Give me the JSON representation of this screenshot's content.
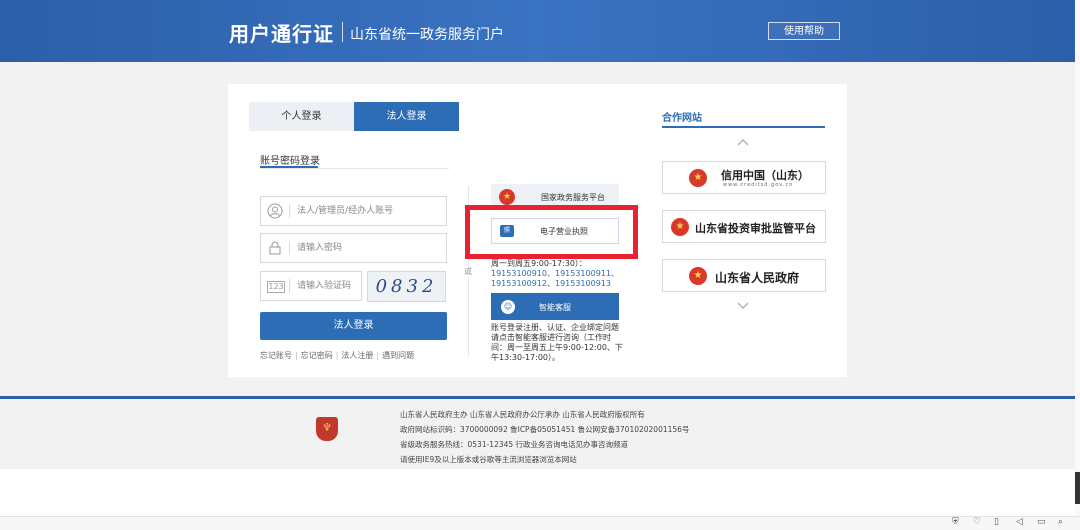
{
  "header": {
    "title": "用户通行证",
    "subtitle": "山东省统一政务服务门户",
    "help_label": "使用帮助"
  },
  "login": {
    "tabs": [
      "个人登录",
      "法人登录"
    ],
    "active_tab": "法人登录",
    "subtab": "账号密码登录",
    "account_placeholder": "法人/管理员/经办人账号",
    "password_placeholder": "请输入密码",
    "captcha_placeholder": "请输入验证码",
    "captcha_image_text": "0832",
    "submit_label": "法人登录",
    "links": [
      "忘记账号",
      "忘记密码",
      "法人注册",
      "遇到问题"
    ]
  },
  "alt_login": {
    "or_label": "或",
    "services": [
      {
        "label": "国家政务服务平台",
        "icon": "national-emblem-icon"
      },
      {
        "label": "电子营业执照",
        "icon": "business-license-icon"
      }
    ],
    "hotline_text": "周一到周五9:00-17:30）：",
    "hotline_numbers": "19153100910、19153100911、19153100912、19153100913",
    "smart_service_label": "智能客服",
    "smart_service_desc": "账号登录注册、认证、企业绑定问题请点击智能客服进行咨询（工作时间：周一至周五上午9:00-12:00、下午13:30-17:00）。"
  },
  "partners": {
    "title": "合作网站",
    "items": [
      {
        "name": "信用中国（山东）",
        "sub": "www.creditsd.gov.cn"
      },
      {
        "name": "山东省投资审批监管平台"
      },
      {
        "name": "山东省人民政府"
      }
    ]
  },
  "footer": {
    "lines": [
      "山东省人民政府主办    山东省人民政府办公厅承办    山东省人民政府版权所有",
      "政府网站标识码：3700000092    鲁ICP备05051451    鲁公网安备37010202001156号",
      "省级政务服务热线：0531-12345    行政业务咨询电话见办事咨询频道",
      "请使用IE9及以上版本或谷歌等主流浏览器浏览本网站"
    ]
  },
  "colors": {
    "brand_blue": "#2d6db5",
    "header_blue": "#2c5fa8",
    "highlight_red": "#e8222e"
  }
}
